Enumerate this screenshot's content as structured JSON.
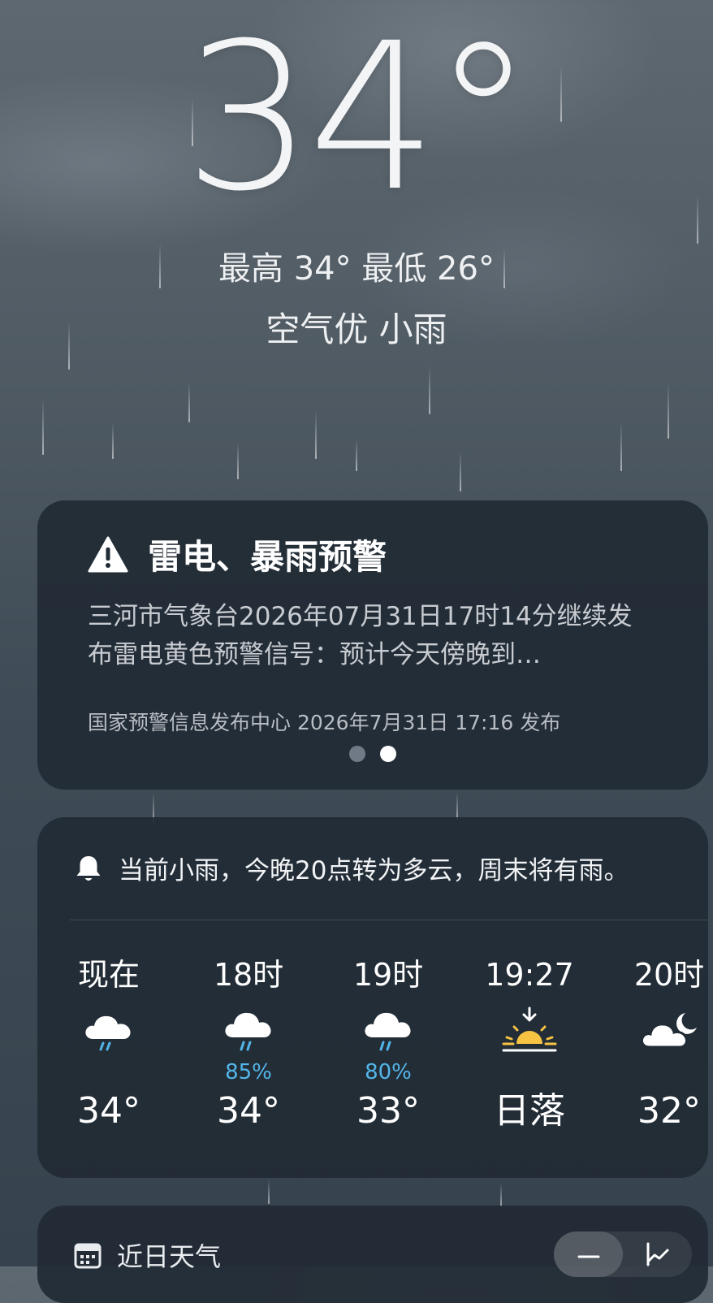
{
  "current": {
    "temperature": "34°",
    "high_low": "最高 34° 最低 26°",
    "condition": "空气优  小雨"
  },
  "alert": {
    "title": "雷电、暴雨预警",
    "body": "三河市气象台2026年07月31日17时14分继续发布雷电黄色预警信号：预计今天傍晚到…",
    "source": "国家预警信息发布中心 2026年7月31日 17:16 发布",
    "page_index": 2,
    "page_count": 2
  },
  "forecast_summary": "当前小雨，今晚20点转为多云，周末将有雨。",
  "hourly": [
    {
      "time": "现在",
      "icon": "light-rain-icon",
      "precip": "",
      "temp": "34°"
    },
    {
      "time": "18时",
      "icon": "rain-icon",
      "precip": "85%",
      "temp": "34°"
    },
    {
      "time": "19时",
      "icon": "rain-icon",
      "precip": "80%",
      "temp": "33°"
    },
    {
      "time": "19:27",
      "icon": "sunset-icon",
      "precip": "",
      "temp": "日落"
    },
    {
      "time": "20时",
      "icon": "partly-cloudy-night-icon",
      "precip": "",
      "temp": "32°"
    }
  ],
  "recent": {
    "title": "近日天气"
  },
  "colors": {
    "card_bg": "#212b35",
    "precip_text": "#53b6ea",
    "sun": "#f6c343"
  }
}
